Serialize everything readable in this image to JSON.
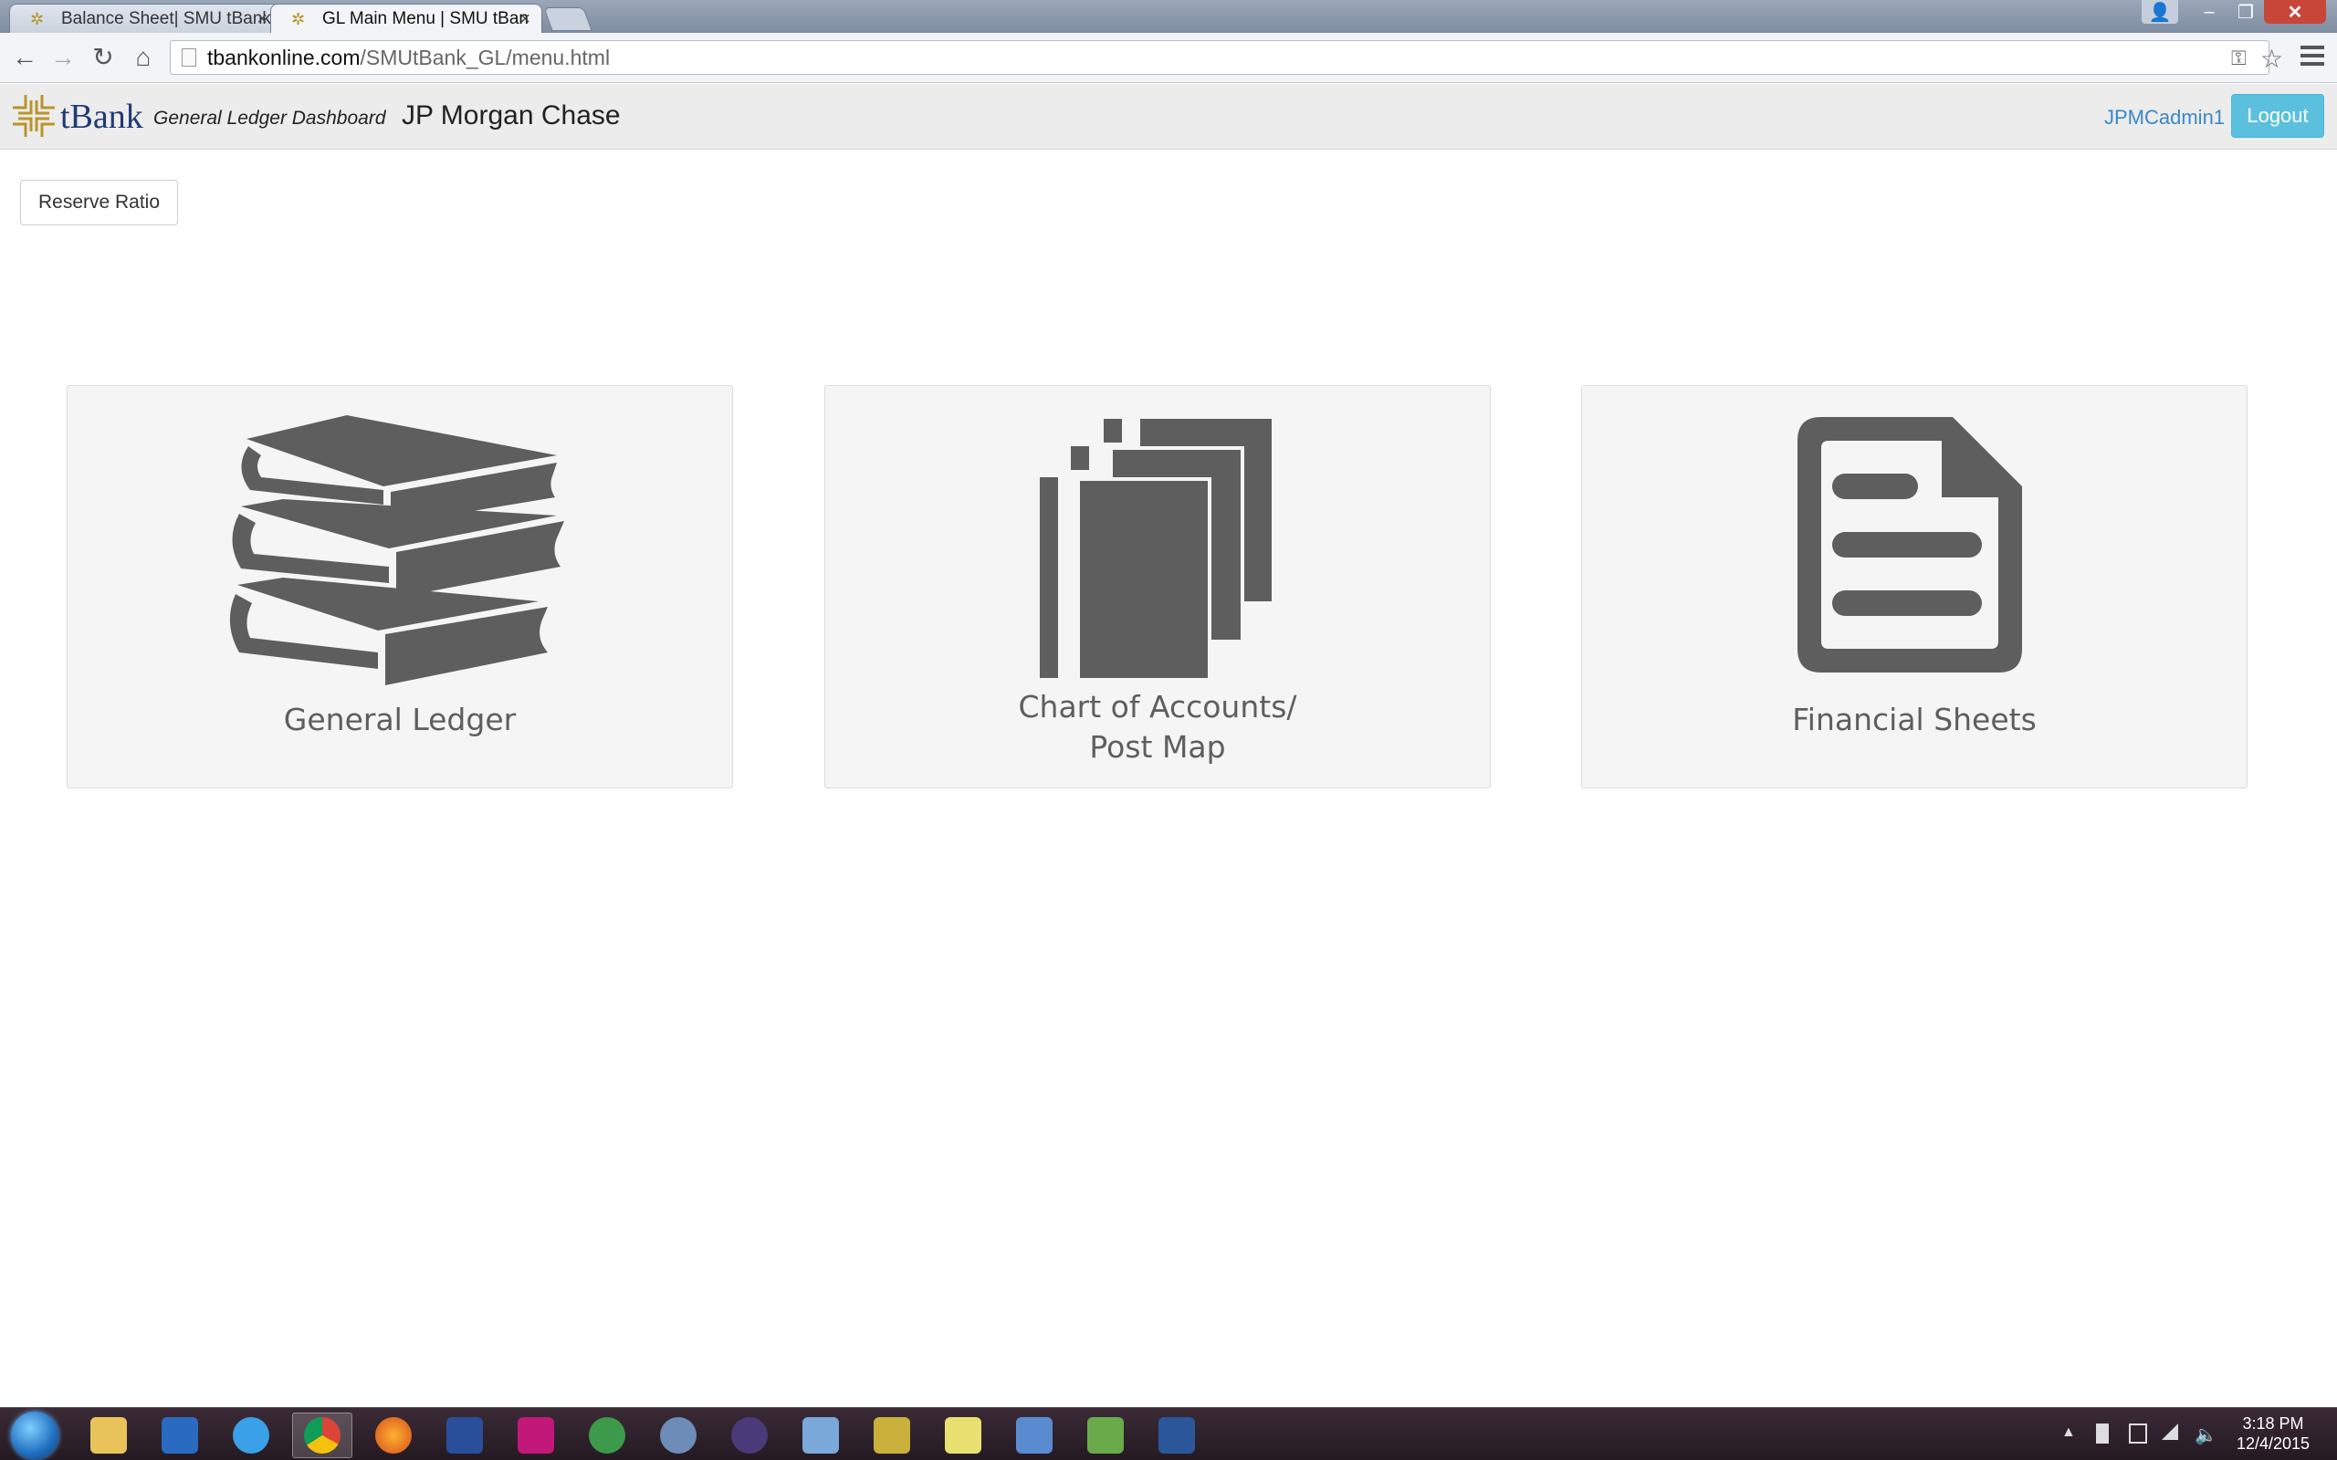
{
  "browser": {
    "tabs": [
      {
        "title": "Balance Sheet| SMU tBank"
      },
      {
        "title": "GL Main Menu | SMU tBan"
      }
    ],
    "url_host": "tbankonline.com",
    "url_path": "/SMUtBank_GL/menu.html"
  },
  "header": {
    "logo_text": "tBank",
    "subtitle": "General Ledger Dashboard",
    "bank_name": "JP Morgan Chase",
    "username": "JPMCadmin1",
    "logout_label": "Logout"
  },
  "toolbar": {
    "reserve_ratio_label": "Reserve Ratio"
  },
  "tiles": [
    {
      "label": "General Ledger",
      "icon": "books-icon"
    },
    {
      "label_line1": "Chart of Accounts/",
      "label_line2": "Post Map",
      "icon": "documents-stack-icon"
    },
    {
      "label": "Financial Sheets",
      "icon": "document-lines-icon"
    }
  ],
  "taskbar": {
    "apps": [
      "outlook-icon",
      "internet-explorer-icon",
      "chrome-icon",
      "firefox-icon",
      "app-blue-icon",
      "app-magenta-icon",
      "app-green-s-icon",
      "gear-icon",
      "eclipse-icon",
      "virtualbox-icon",
      "lock-icon",
      "sticky-notes-icon",
      "remote-desktop-icon",
      "spreadsheet-icon",
      "word-icon"
    ],
    "time": "3:18 PM",
    "date": "12/4/2015"
  },
  "colors": {
    "accent_button": "#5bc0de",
    "username_link": "#3a88c8",
    "icon_gray": "#5e5e5e",
    "tile_bg": "#f5f5f5"
  }
}
